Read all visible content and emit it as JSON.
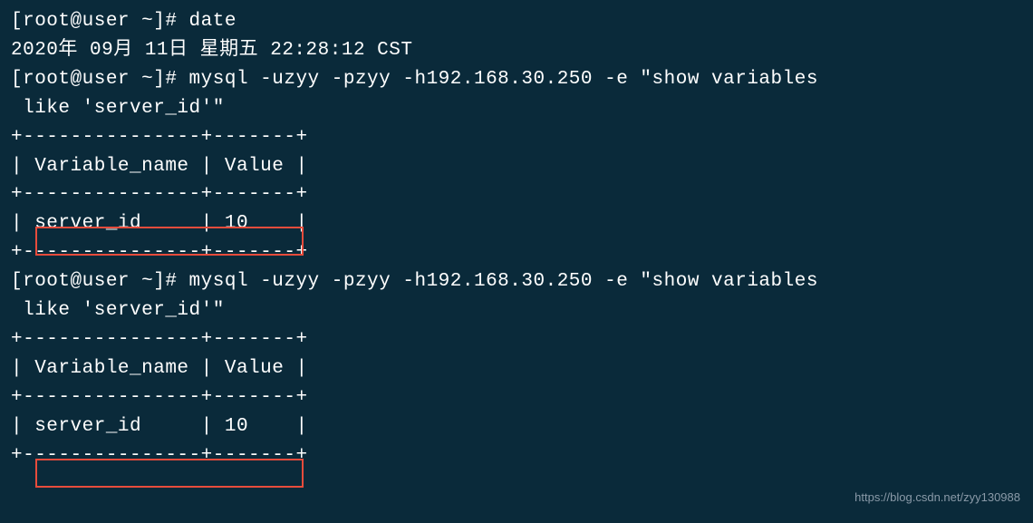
{
  "lines": {
    "l1": "[root@user ~]# date",
    "l2": "2020年 09月 11日 星期五 22:28:12 CST",
    "l3": "[root@user ~]# mysql -uzyy -pzyy -h192.168.30.250 -e \"show variables",
    "l4": " like 'server_id'\"",
    "l5": "+---------------+-------+",
    "l6": "| Variable_name | Value |",
    "l7": "+---------------+-------+",
    "l8": "| server_id     | 10    |",
    "l9": "+---------------+-------+",
    "l10": "[root@user ~]# mysql -uzyy -pzyy -h192.168.30.250 -e \"show variables",
    "l11": " like 'server_id'\"",
    "l12": "+---------------+-------+",
    "l13": "| Variable_name | Value |",
    "l14": "+---------------+-------+",
    "l15": "| server_id     | 10    |",
    "l16": "+---------------+-------+"
  },
  "watermark": "https://blog.csdn.net/zyy130988"
}
